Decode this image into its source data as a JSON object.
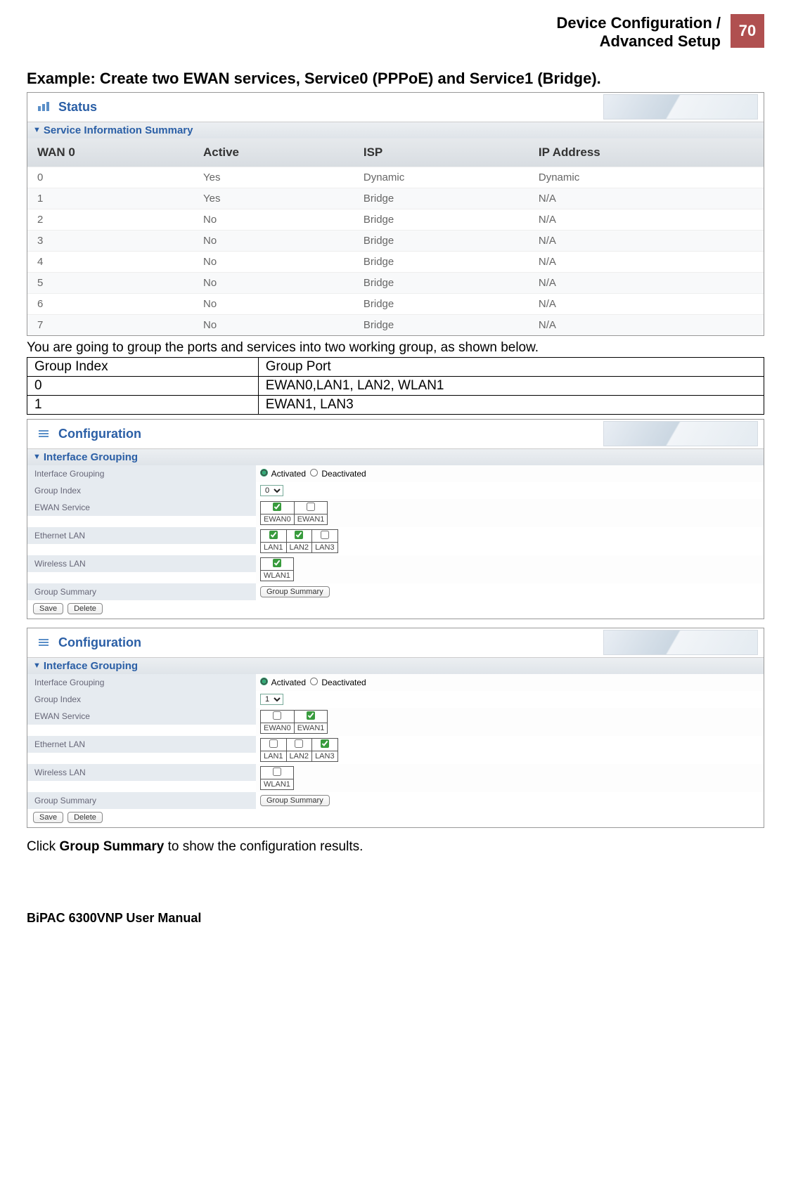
{
  "header": {
    "title_line1": "Device Configuration /",
    "title_line2": "Advanced Setup",
    "page_num": "70"
  },
  "example_heading": "Example: Create two EWAN services, Service0 (PPPoE) and Service1 (Bridge).",
  "status_panel": {
    "title": "Status",
    "section": "Service Information Summary",
    "cols": [
      "WAN 0",
      "Active",
      "ISP",
      "IP Address"
    ],
    "rows": [
      [
        "0",
        "Yes",
        "Dynamic",
        "Dynamic"
      ],
      [
        "1",
        "Yes",
        "Bridge",
        "N/A"
      ],
      [
        "2",
        "No",
        "Bridge",
        "N/A"
      ],
      [
        "3",
        "No",
        "Bridge",
        "N/A"
      ],
      [
        "4",
        "No",
        "Bridge",
        "N/A"
      ],
      [
        "5",
        "No",
        "Bridge",
        "N/A"
      ],
      [
        "6",
        "No",
        "Bridge",
        "N/A"
      ],
      [
        "7",
        "No",
        "Bridge",
        "N/A"
      ]
    ]
  },
  "intro_text": "You are going to group the ports and services into two working group, as shown below.",
  "group_table": {
    "cols": [
      "Group Index",
      "Group Port"
    ],
    "rows": [
      [
        "0",
        "EWAN0,LAN1, LAN2, WLAN1"
      ],
      [
        "1",
        "EWAN1, LAN3"
      ]
    ]
  },
  "cfg_panel": {
    "title": "Configuration",
    "section": "Interface Grouping",
    "labels": {
      "iface_grouping": "Interface Grouping",
      "group_index": "Group Index",
      "ewan_service": "EWAN Service",
      "eth_lan": "Ethernet LAN",
      "wlan": "Wireless LAN",
      "group_summary": "Group Summary"
    },
    "radio": {
      "activated": "Activated",
      "deactivated": "Deactivated"
    },
    "ewan_cols": [
      "EWAN0",
      "EWAN1"
    ],
    "lan_cols": [
      "LAN1",
      "LAN2",
      "LAN3"
    ],
    "wlan_cols": [
      "WLAN1"
    ],
    "buttons": {
      "group_summary": "Group Summary",
      "save": "Save",
      "delete": "Delete"
    },
    "instances": [
      {
        "group_index": "0",
        "ewan": [
          true,
          false
        ],
        "lan": [
          true,
          true,
          false
        ],
        "wlan": [
          true
        ]
      },
      {
        "group_index": "1",
        "ewan": [
          false,
          true
        ],
        "lan": [
          false,
          false,
          true
        ],
        "wlan": [
          false
        ]
      }
    ]
  },
  "footer_click": {
    "pre": "Click ",
    "bold": "Group Summary",
    "post": " to show the configuration results."
  },
  "footer_brand": "BiPAC 6300VNP User Manual"
}
